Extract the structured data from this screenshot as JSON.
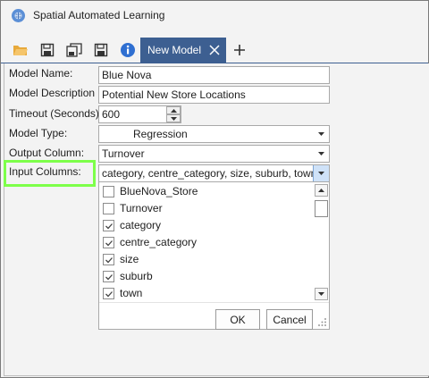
{
  "app": {
    "title": "Spatial Automated Learning"
  },
  "toolbar": {
    "buttons": [
      {
        "icon": "open-folder-icon"
      },
      {
        "icon": "save-icon"
      },
      {
        "icon": "save-all-icon"
      },
      {
        "icon": "save-as-icon"
      },
      {
        "icon": "info-icon"
      }
    ],
    "active_tab_label": "New Model",
    "accent_color": "#3d5f91"
  },
  "form": {
    "model_name": {
      "label": "Model Name:",
      "value": "Blue Nova"
    },
    "model_description": {
      "label": "Model Description",
      "value": "Potential New Store Locations"
    },
    "timeout": {
      "label": "Timeout (Seconds):",
      "value": "600"
    },
    "model_type": {
      "label": "Model Type:",
      "value": "Regression"
    },
    "output_column": {
      "label": "Output Column:",
      "value": "Turnover"
    },
    "input_columns": {
      "label": "Input Columns:",
      "value": "category, centre_category, size, suburb, town...",
      "highlight_color": "#7dff4a"
    }
  },
  "dropdown": {
    "items": [
      {
        "label": "BlueNova_Store",
        "checked": false
      },
      {
        "label": "Turnover",
        "checked": false
      },
      {
        "label": "category",
        "checked": true
      },
      {
        "label": "centre_category",
        "checked": true
      },
      {
        "label": "size",
        "checked": true
      },
      {
        "label": "suburb",
        "checked": true
      },
      {
        "label": "town",
        "checked": true
      }
    ],
    "ok_label": "OK",
    "cancel_label": "Cancel"
  }
}
